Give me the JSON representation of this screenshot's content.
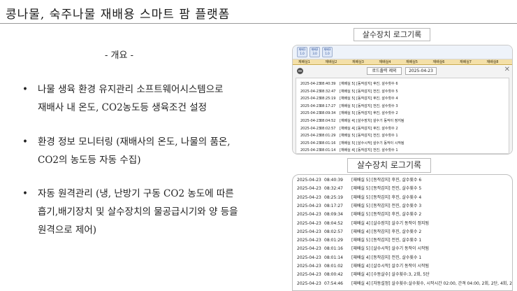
{
  "slide": {
    "title": "콩나물, 숙주나물 재배용 스마트 팜 플랫폼",
    "subhead": "- 개요 -",
    "bullets": [
      {
        "mark": "•",
        "lines": [
          "나물 생육 환경 유지관리 소프트웨어시스템으로",
          "재배사 내 온도, CO2농도등 생육조건 설정"
        ]
      },
      {
        "mark": "•",
        "lines": [
          "환경 정보 모니터링 (재배사의 온도, 나물의 품온,",
          "CO2의 농도등 자동 수집)"
        ]
      },
      {
        "mark": "•",
        "lines": [
          "자동 원격관리 (냉, 난방기 구동 CO2 농도에 따른",
          "흡기,배기장치 및 살수장치의 물공급시기와 양 등을",
          "원격으로 제어)"
        ]
      }
    ]
  },
  "caption_small": "살수장치 로그기록",
  "caption_large": "살수장치 로그기록",
  "small_window": {
    "sensors": [
      [
        "재배1",
        "1.0"
      ],
      [
        "재배2",
        "3.0"
      ],
      [
        "재배3",
        "1.0"
      ]
    ],
    "tabs": [
      "재배실1",
      "재배실2",
      "재배실3",
      "재배실4",
      "재배실5",
      "재배실6",
      "재배실7",
      "재배실8"
    ],
    "filter_button": "로드출력 제외",
    "date": "2025-04-23",
    "close": "✕",
    "rows": [
      [
        "2025-04-23",
        "08:40:39",
        "[재배실 5] [동작감지] 후진, 살수횟수 6"
      ],
      [
        "2025-04-23",
        "08:32:47",
        "[재배실 5] [동작감지] 전진, 살수횟수 5"
      ],
      [
        "2025-04-23",
        "08:25:19",
        "[재배실 5] [동작감지] 후진, 살수횟수 4"
      ],
      [
        "2025-04-23",
        "08:17:27",
        "[재배실 5] [동작감지] 전진, 살수횟수 3"
      ],
      [
        "2025-04-23",
        "08:09:34",
        "[재배실 5] [동작감지] 후진, 살수횟수 2"
      ],
      [
        "2025-04-23",
        "08:04:52",
        "[재배실 4] [살수장치] 살수기 동작이 정지됨"
      ],
      [
        "2025-04-23",
        "08:02:57",
        "[재배실 4] [동작감지] 후진, 살수횟수 2"
      ],
      [
        "2025-04-23",
        "08:01:29",
        "[재배실 5] [동작감지] 전진, 살수횟수 1"
      ],
      [
        "2025-04-23",
        "08:01:16",
        "[재배실 5] [살수시작] 살수기 동작이 시작됨"
      ],
      [
        "2025-04-23",
        "08:01:14",
        "[재배실 4] [동작감지] 전진, 살수횟수 1"
      ]
    ]
  },
  "large_window": {
    "rows": [
      [
        "2025-04-23",
        "08:40:39",
        "[재배실 5] [동작감지] 후진, 살수횟수 6"
      ],
      [
        "2025-04-23",
        "08:32:47",
        "[재배실 5] [동작감지] 전진, 살수횟수 5"
      ],
      [
        "2025-04-23",
        "08:25:19",
        "[재배실 5] [동작감지] 후진, 살수횟수 4"
      ],
      [
        "2025-04-23",
        "08:17:27",
        "[재배실 5] [동작감지] 전진, 살수횟수 3"
      ],
      [
        "2025-04-23",
        "08:09:34",
        "[재배실 5] [동작감지] 후진, 살수횟수 2"
      ],
      [
        "2025-04-23",
        "08:04:52",
        "[재배실 4] [살수장치] 살수기 동작이 정지됨"
      ],
      [
        "2025-04-23",
        "08:02:57",
        "[재배실 4] [동작감지] 후진, 살수횟수 2"
      ],
      [
        "2025-04-23",
        "08:01:29",
        "[재배실 5] [동작감지] 전진, 살수횟수 1"
      ],
      [
        "2025-04-23",
        "08:01:16",
        "[재배실 5] [살수시작] 살수기 동작이 시작됨"
      ],
      [
        "2025-04-23",
        "08:01:14",
        "[재배실 4] [동작감지] 전진, 살수횟수 1"
      ],
      [
        "2025-04-23",
        "08:01:02",
        "[재배실 4] [살수시작] 살수기 동작이 시작됨"
      ],
      [
        "2025-04-23",
        "08:00:42",
        "[재배실 4] [수동살수] 살수횟수:3, 2회, 5단"
      ],
      [
        "2025-04-23",
        "07:54:46",
        "[재배실 4] [자동설정] 살수횟수:살수횟수, 시작시간 02:00, 간격 04:00, 2회, 2단, 4회, 2단"
      ]
    ]
  }
}
